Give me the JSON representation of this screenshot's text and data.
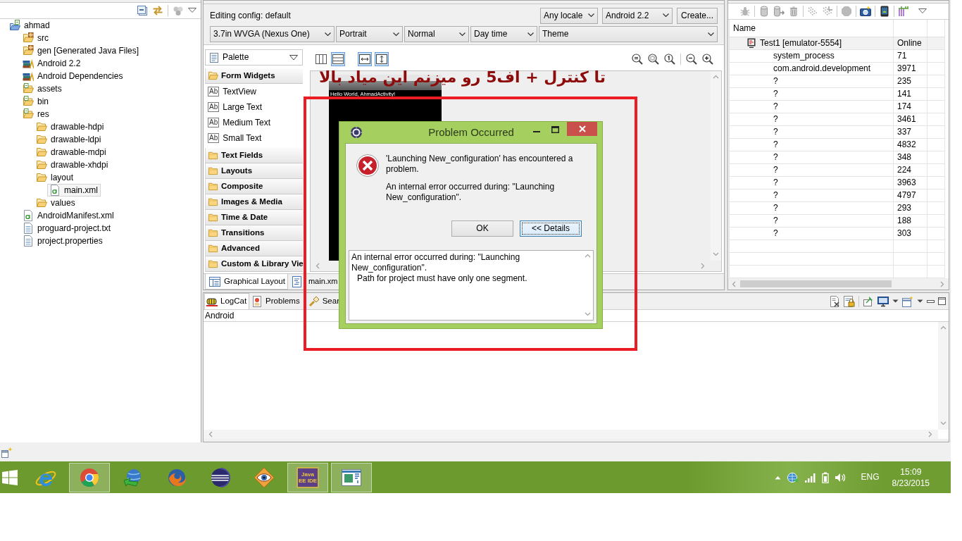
{
  "package_explorer": {
    "tree": [
      {
        "label": "ahmad",
        "kind": "project",
        "selected": false,
        "children": [
          {
            "label": "src",
            "kind": "package-folder",
            "selected": false
          },
          {
            "label": "gen [Generated Java Files]",
            "kind": "package-folder",
            "selected": false
          },
          {
            "label": "Android 2.2",
            "kind": "library",
            "selected": false
          },
          {
            "label": "Android Dependencies",
            "kind": "library",
            "selected": false
          },
          {
            "label": "assets",
            "kind": "resource-folder",
            "selected": false
          },
          {
            "label": "bin",
            "kind": "resource-folder",
            "selected": false
          },
          {
            "label": "res",
            "kind": "resource-folder",
            "selected": false,
            "children": [
              {
                "label": "drawable-hdpi",
                "kind": "folder",
                "selected": false
              },
              {
                "label": "drawable-ldpi",
                "kind": "folder",
                "selected": false
              },
              {
                "label": "drawable-mdpi",
                "kind": "folder",
                "selected": false
              },
              {
                "label": "drawable-xhdpi",
                "kind": "folder",
                "selected": false
              },
              {
                "label": "layout",
                "kind": "folder",
                "selected": false,
                "children": [
                  {
                    "label": "main.xml",
                    "kind": "xml-file",
                    "selected": true
                  }
                ]
              },
              {
                "label": "values",
                "kind": "folder",
                "selected": false
              }
            ]
          },
          {
            "label": "AndroidManifest.xml",
            "kind": "xml-file",
            "selected": false
          },
          {
            "label": "proguard-project.txt",
            "kind": "text-file",
            "selected": false
          },
          {
            "label": "project.properties",
            "kind": "text-file",
            "selected": false
          }
        ]
      }
    ]
  },
  "layout_editor": {
    "config_label": "Editing config: default",
    "top_dropdowns": [
      "Any locale",
      "Android 2.2"
    ],
    "create_button": "Create...",
    "dropdowns": [
      "3.7in WVGA (Nexus One)",
      "Portrait",
      "Normal",
      "Day time",
      "Theme"
    ],
    "palette": {
      "title": "Palette",
      "categories": [
        {
          "label": "Form Widgets",
          "expanded": true,
          "items": [
            {
              "glyph": "Ab",
              "label": "TextView"
            },
            {
              "glyph": "Ab",
              "label": "Large Text"
            },
            {
              "glyph": "Ab",
              "label": "Medium Text"
            },
            {
              "glyph": "Ab",
              "label": "Small Text"
            }
          ]
        },
        {
          "label": "Text Fields",
          "expanded": false
        },
        {
          "label": "Layouts",
          "expanded": false
        },
        {
          "label": "Composite",
          "expanded": false
        },
        {
          "label": "Images & Media",
          "expanded": false
        },
        {
          "label": "Time & Date",
          "expanded": false
        },
        {
          "label": "Transitions",
          "expanded": false
        },
        {
          "label": "Advanced",
          "expanded": false
        },
        {
          "label": "Custom & Library Vie",
          "expanded": false
        }
      ]
    },
    "view_toggles": [
      {
        "kind": "columns",
        "selected": false
      },
      {
        "kind": "rows",
        "selected": true
      },
      {
        "kind": "fit-width",
        "selected": true
      },
      {
        "kind": "fit-height",
        "selected": true
      }
    ],
    "preview": {
      "greeting": "Hello World, AhmadActivity!"
    },
    "tabs": [
      {
        "label": "Graphical Layout",
        "selected": true
      },
      {
        "label": "main.xm",
        "selected": false
      }
    ]
  },
  "devices": {
    "columns": [
      "Name"
    ],
    "rows": [
      {
        "kind": "device",
        "name": "Test1 [emulator-5554]",
        "column_2": "Online",
        "children": [
          {
            "kind": "process",
            "name": "system_process",
            "column_2": "71"
          },
          {
            "kind": "process",
            "name": "com.android.development",
            "column_2": "3971"
          },
          {
            "kind": "process",
            "name": "?",
            "column_2": "235"
          },
          {
            "kind": "process",
            "name": "?",
            "column_2": "141"
          },
          {
            "kind": "process",
            "name": "?",
            "column_2": "174"
          },
          {
            "kind": "process",
            "name": "?",
            "column_2": "3461"
          },
          {
            "kind": "process",
            "name": "?",
            "column_2": "337"
          },
          {
            "kind": "process",
            "name": "?",
            "column_2": "4832"
          },
          {
            "kind": "process",
            "name": "?",
            "column_2": "348"
          },
          {
            "kind": "process",
            "name": "?",
            "column_2": "224"
          },
          {
            "kind": "process",
            "name": "?",
            "column_2": "3963"
          },
          {
            "kind": "process",
            "name": "?",
            "column_2": "4797"
          },
          {
            "kind": "process",
            "name": "?",
            "column_2": "293"
          },
          {
            "kind": "process",
            "name": "?",
            "column_2": "188"
          },
          {
            "kind": "process",
            "name": "?",
            "column_2": "303"
          }
        ]
      }
    ]
  },
  "console": {
    "tabs": [
      {
        "label": "LogCat",
        "selected": true
      },
      {
        "label": "Problems",
        "selected": false
      },
      {
        "label": "Sear",
        "selected": false
      }
    ],
    "list_header": "Android"
  },
  "annotation": {
    "text": "تا کنترل + اف5 رو میزنم این میاد بالا"
  },
  "dialog": {
    "title": "Problem Occurred",
    "message": "'Launching New_configuration' has encountered a problem.",
    "reason": "An internal error occurred during: \"Launching New_configuration\".",
    "buttons": [
      {
        "label": "OK",
        "focused": false
      },
      {
        "label": "<< Details",
        "focused": true
      }
    ],
    "details": {
      "message": "An internal error occurred during: \"Launching New_configuration\".",
      "children": [
        {
          "message": "Path for project must have only one segment."
        }
      ]
    }
  },
  "taskbar": {
    "apps": [
      {
        "kind": "e-logo",
        "running": false
      },
      {
        "kind": "ring-logo",
        "running": true
      },
      {
        "kind": "globe-arrow",
        "running": false
      },
      {
        "kind": "fox-logo",
        "running": false
      },
      {
        "kind": "striped-sphere",
        "running": false
      },
      {
        "kind": "eye",
        "running": false
      },
      {
        "kind": "logo-tile",
        "running": true,
        "logo_text": "Java EE IDE"
      },
      {
        "kind": "window",
        "running": true
      }
    ],
    "language": "ENG",
    "time": "15:09",
    "date": "8/23/2015"
  }
}
